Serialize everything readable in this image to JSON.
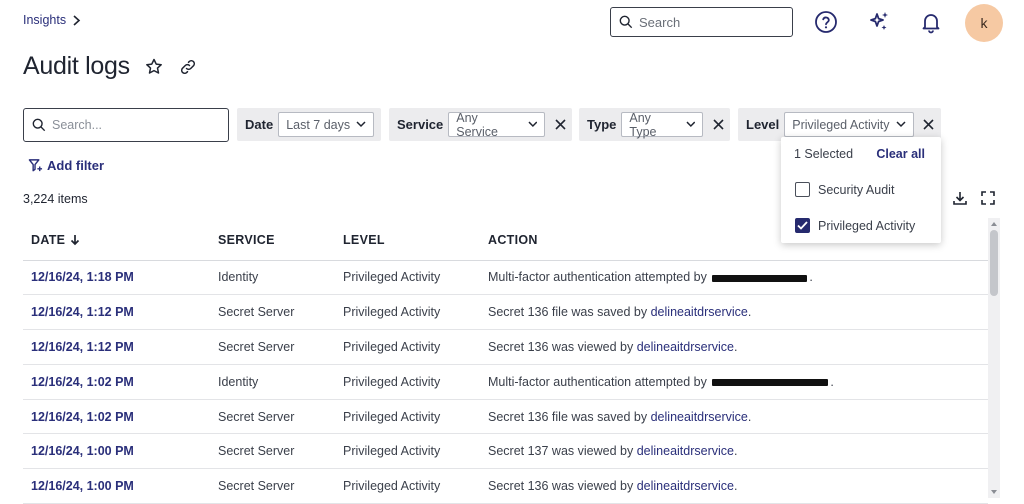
{
  "breadcrumb": {
    "label": "Insights"
  },
  "topbar": {
    "search_placeholder": "Search",
    "avatar_initial": "k"
  },
  "page": {
    "title": "Audit logs"
  },
  "filters": {
    "search_placeholder": "Search...",
    "date": {
      "label": "Date",
      "value": "Last 7 days"
    },
    "service": {
      "label": "Service",
      "value": "Any Service"
    },
    "type": {
      "label": "Type",
      "value": "Any Type"
    },
    "level": {
      "label": "Level",
      "value": "Privileged Activity"
    },
    "add_filter_label": "Add filter"
  },
  "level_dropdown": {
    "selected_count": "1 Selected",
    "clear_all": "Clear all",
    "options": [
      {
        "label": "Security Audit",
        "checked": false
      },
      {
        "label": "Privileged Activity",
        "checked": true
      }
    ]
  },
  "items_count": "3,224 items",
  "table": {
    "columns": [
      "DATE",
      "SERVICE",
      "LEVEL",
      "ACTION"
    ],
    "rows": [
      {
        "date": "12/16/24, 1:18 PM",
        "service": "Identity",
        "level": "Privileged Activity",
        "action_prefix": "Multi-factor authentication attempted by",
        "action_link": "",
        "action_suffix": "."
      },
      {
        "date": "12/16/24, 1:12 PM",
        "service": "Secret Server",
        "level": "Privileged Activity",
        "action_prefix": "Secret 136 file was saved by",
        "action_link": "delineaitdrservice",
        "action_suffix": "."
      },
      {
        "date": "12/16/24, 1:12 PM",
        "service": "Secret Server",
        "level": "Privileged Activity",
        "action_prefix": "Secret 136 was viewed by",
        "action_link": "delineaitdrservice",
        "action_suffix": "."
      },
      {
        "date": "12/16/24, 1:02 PM",
        "service": "Identity",
        "level": "Privileged Activity",
        "action_prefix": "Multi-factor authentication attempted by",
        "action_link": "",
        "action_suffix": "."
      },
      {
        "date": "12/16/24, 1:02 PM",
        "service": "Secret Server",
        "level": "Privileged Activity",
        "action_prefix": "Secret 136 file was saved by",
        "action_link": "delineaitdrservice",
        "action_suffix": "."
      },
      {
        "date": "12/16/24, 1:00 PM",
        "service": "Secret Server",
        "level": "Privileged Activity",
        "action_prefix": "Secret 137 was viewed by",
        "action_link": "delineaitdrservice",
        "action_suffix": "."
      },
      {
        "date": "12/16/24, 1:00 PM",
        "service": "Secret Server",
        "level": "Privileged Activity",
        "action_prefix": "Secret 136 was viewed by",
        "action_link": "delineaitdrservice",
        "action_suffix": "."
      }
    ]
  },
  "colors": {
    "accent": "#2a2f7a",
    "chip_bg": "#ececee",
    "avatar_bg": "#f6c9a3",
    "checkbox_checked": "#262a6e"
  }
}
